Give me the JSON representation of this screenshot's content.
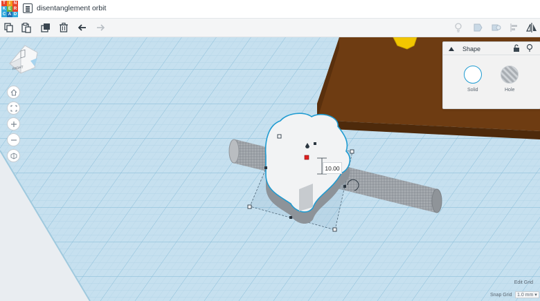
{
  "app": {
    "logo_letters": [
      "T",
      "I",
      "N",
      "K",
      "E",
      "R",
      "C",
      "A",
      "D"
    ],
    "design_title": "disentanglement orbit"
  },
  "toolbar": {
    "left_icons": [
      "copy-icon",
      "paste-icon",
      "duplicate-icon",
      "trash-icon",
      "undo-icon",
      "redo-icon"
    ],
    "right_icons": [
      "light-bulb-icon",
      "group-icon",
      "ungroup-icon",
      "align-icon",
      "mirror-icon"
    ]
  },
  "viewcube": {
    "face_label": "RIGHT"
  },
  "nav_icons": [
    "home-icon",
    "fit-all-icon",
    "zoom-in-icon",
    "zoom-out-icon",
    "ortho-view-icon"
  ],
  "shape_panel": {
    "title": "Shape",
    "solid_label": "Solid",
    "hole_label": "Hole"
  },
  "workplane": {
    "dimension_value": "10.00",
    "edit_grid_label": "Edit Grid",
    "snap_grid_label": "Snap Grid",
    "snap_grid_value": "1.0 mm"
  },
  "colors": {
    "workplane": "#c6e0ef",
    "grid_line": "#a9cfe3",
    "brown_box": "#6e3c12",
    "yellow_shape": "#f2c600",
    "accent": "#1f9bd1",
    "hole_gray": "#9a9ea3",
    "handle_red": "#e02020"
  }
}
